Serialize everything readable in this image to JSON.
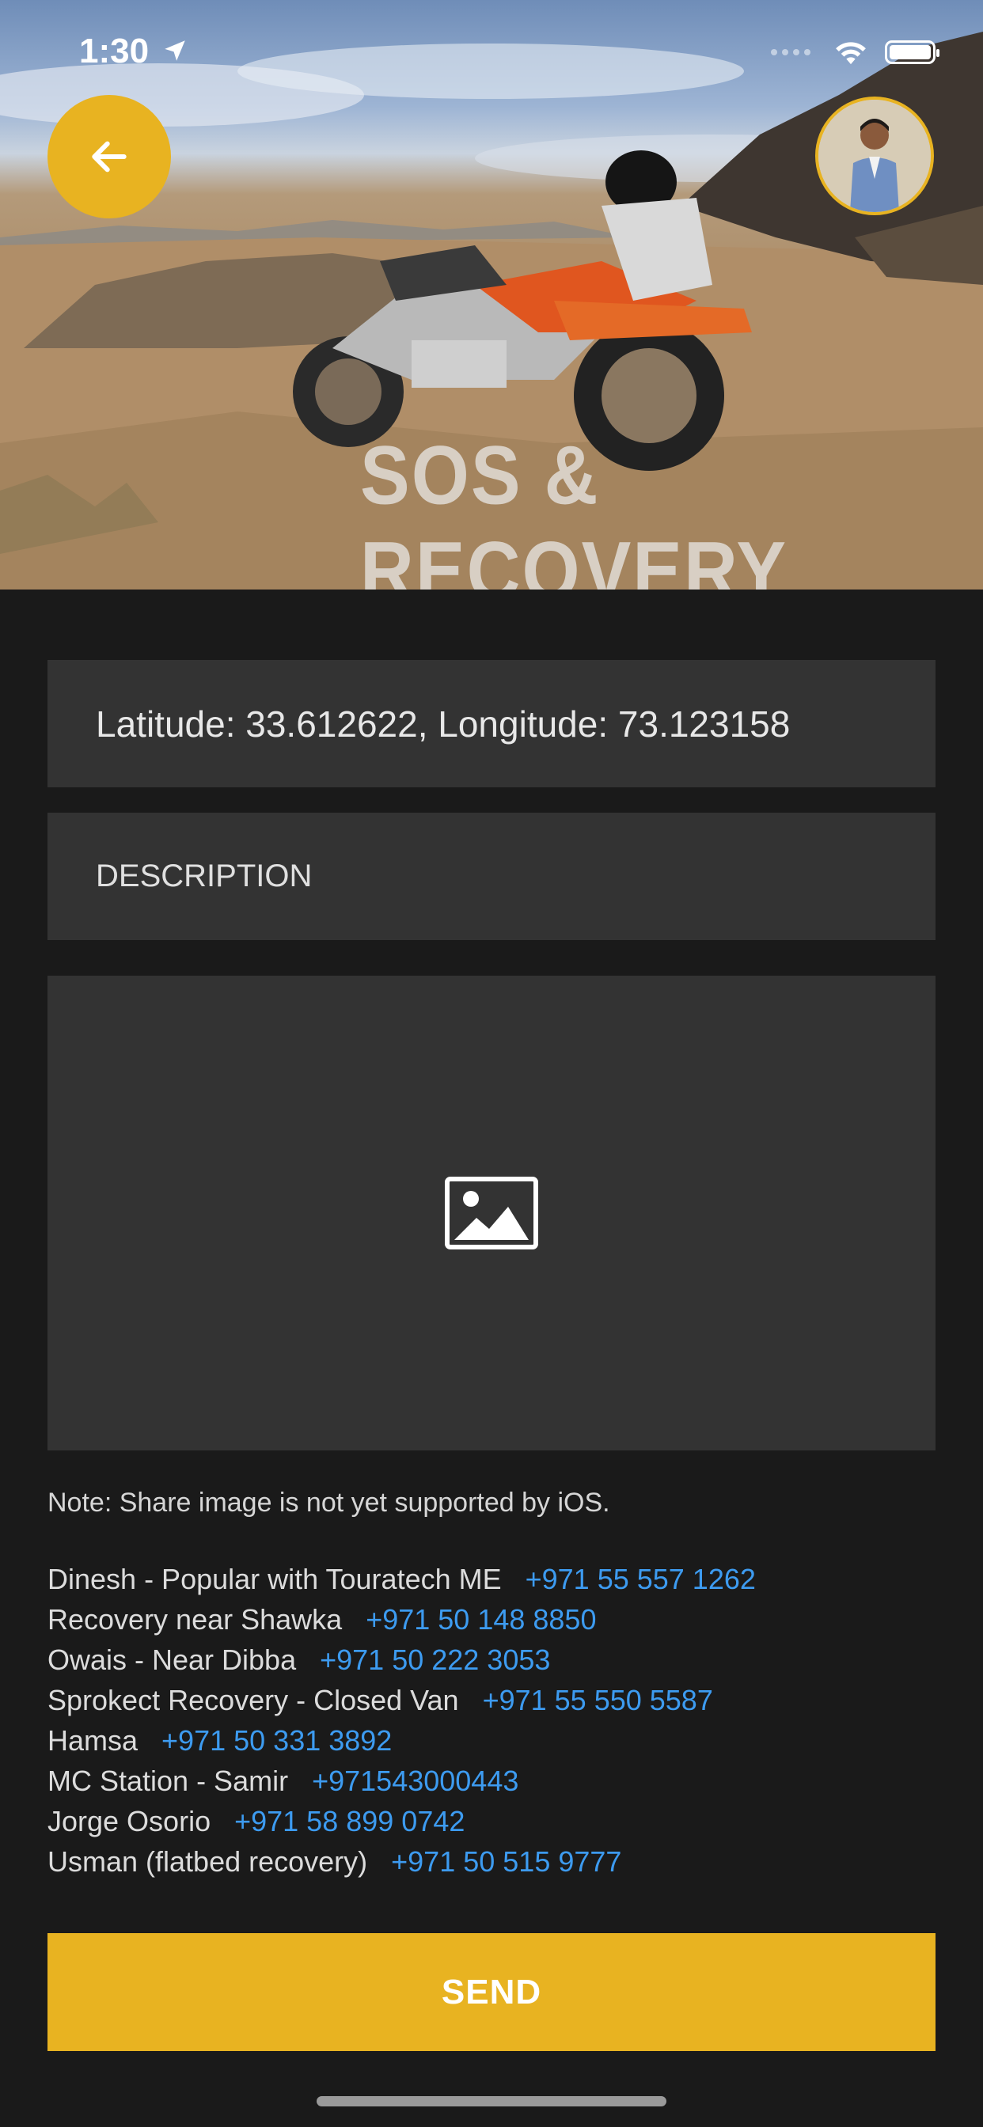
{
  "status_bar": {
    "time": "1:30"
  },
  "hero": {
    "title": "SOS & RECOVERY"
  },
  "form": {
    "location_value": "Latitude: 33.612622, Longitude: 73.123158",
    "description_placeholder": "DESCRIPTION"
  },
  "note": "Note: Share image is not yet supported by iOS.",
  "contacts": [
    {
      "name": "Dinesh - Popular with Touratech ME",
      "phone": "+971 55 557 1262"
    },
    {
      "name": "Recovery near Shawka",
      "phone": "+971 50 148 8850"
    },
    {
      "name": "Owais - Near Dibba",
      "phone": "+971 50 222 3053"
    },
    {
      "name": "Sprokect Recovery - Closed Van",
      "phone": "+971 55 550 5587"
    },
    {
      "name": "Hamsa",
      "phone": "+971 50 331 3892"
    },
    {
      "name": "MC Station - Samir",
      "phone": "+971543000443"
    },
    {
      "name": "Jorge Osorio",
      "phone": "+971 58 899 0742"
    },
    {
      "name": "Usman (flatbed recovery)",
      "phone": "+971 50 515 9777"
    }
  ],
  "send_label": "SEND",
  "colors": {
    "accent": "#e8b321",
    "link": "#3d9bf0",
    "background": "#1a1a1a",
    "field": "#333333"
  },
  "icons": {
    "back": "arrow-left-icon",
    "image_placeholder": "image-icon",
    "location_arrow": "location-arrow-icon"
  }
}
